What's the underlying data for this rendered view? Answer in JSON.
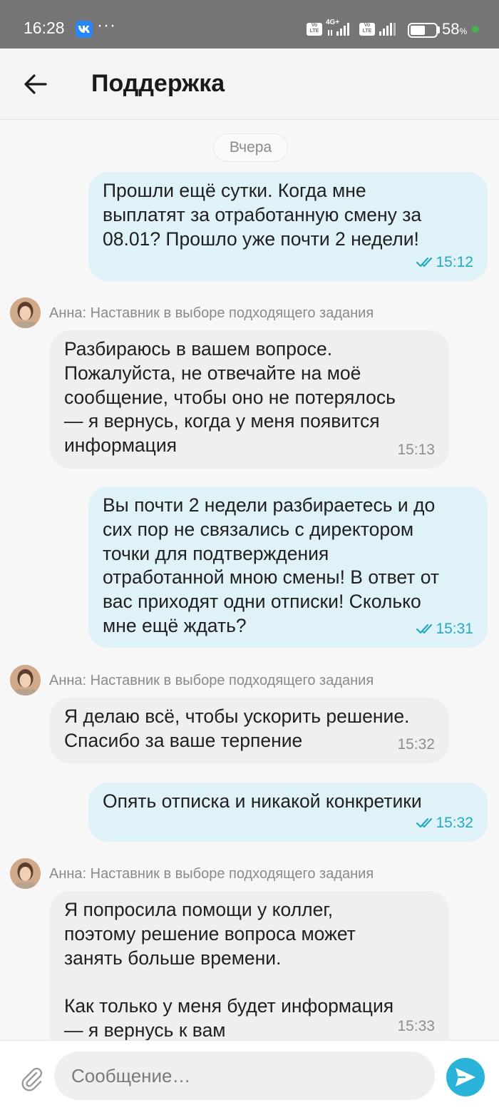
{
  "status_bar": {
    "time": "16:28",
    "app_icon": "vk-icon",
    "overflow": "···",
    "network": "4G+",
    "volte_label": "Vo LTE",
    "battery_percent": "58",
    "battery_level": 0.58,
    "percent_sign": "%"
  },
  "header": {
    "title": "Поддержка",
    "back_icon": "arrow-left-icon"
  },
  "chat": {
    "date_divider": "Вчера",
    "messages": [
      {
        "direction": "outgoing",
        "text": "Прошли ещё сутки. Когда мне\nвыплатят за отработанную смену за\n08.01? Прошло уже почти 2 недели!",
        "time": "15:12",
        "status": "read"
      },
      {
        "direction": "incoming",
        "sender": "Анна: Наставник в выборе подходящего задания",
        "text": "Разбираюсь в вашем вопросе.\nПожалуйста, не отвечайте на моё\nсообщение, чтобы оно не потерялось\n— я вернусь, когда у меня появится\nинформация",
        "time": "15:13"
      },
      {
        "direction": "outgoing",
        "text": "Вы почти 2 недели разбираетесь и до\nсих пор не связались с директором\nточки для подтверждения\nотработанной мною смены! В ответ от\nвас приходят одни отписки! Сколько\nмне ещё ждать?",
        "time": "15:31",
        "status": "read"
      },
      {
        "direction": "incoming",
        "sender": "Анна: Наставник в выборе подходящего задания",
        "text": "Я делаю всё, чтобы ускорить решение.\nСпасибо за ваше терпение",
        "time": "15:32"
      },
      {
        "direction": "outgoing",
        "text": "Опять отписка и никакой конкретики",
        "time": "15:32",
        "status": "read"
      },
      {
        "direction": "incoming",
        "sender": "Анна: Наставник в выборе подходящего задания",
        "text": "Я попросила помощи у коллег,\nпоэтому решение вопроса может\nзанять больше времени.\n\nКак только у меня будет информация\n— я вернусь к вам",
        "time": "15:33"
      }
    ]
  },
  "composer": {
    "placeholder": "Сообщение…",
    "value": "",
    "attach_icon": "paperclip-icon",
    "send_icon": "send-icon"
  },
  "colors": {
    "outgoing_bubble": "#dff2f7",
    "incoming_bubble": "#efeff1",
    "accent": "#29b3d9",
    "read_ticks": "#28a8be",
    "status_bar": "#757575"
  }
}
